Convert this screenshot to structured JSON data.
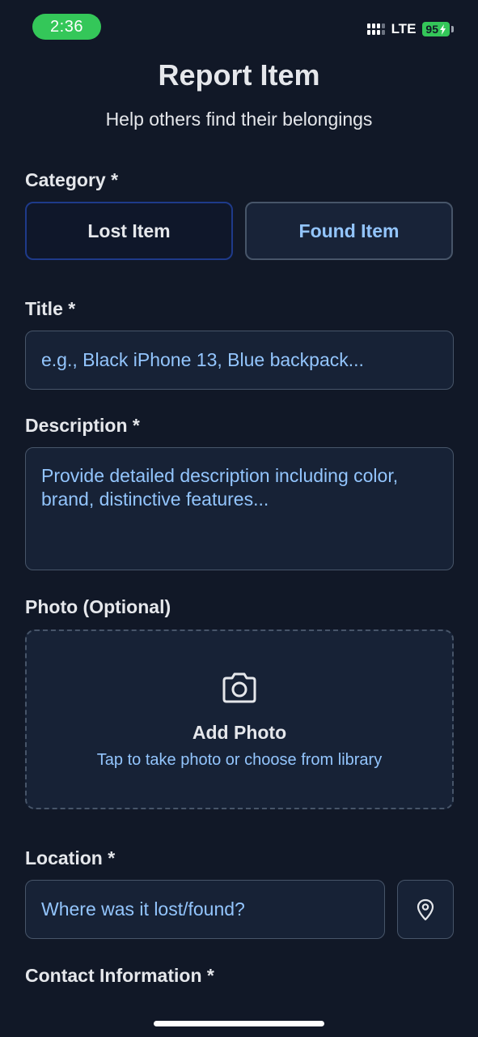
{
  "status_bar": {
    "time": "2:36",
    "network": "LTE",
    "battery": "95"
  },
  "header": {
    "title": "Report Item",
    "subtitle": "Help others find their belongings"
  },
  "form": {
    "category": {
      "label": "Category *",
      "options": [
        {
          "label": "Lost Item"
        },
        {
          "label": "Found Item"
        }
      ]
    },
    "title": {
      "label": "Title *",
      "placeholder": "e.g., Black iPhone 13, Blue backpack..."
    },
    "description": {
      "label": "Description *",
      "placeholder": "Provide detailed description including color, brand, distinctive features..."
    },
    "photo": {
      "label": "Photo (Optional)",
      "button_title": "Add Photo",
      "hint": "Tap to take photo or choose from library",
      "icon": "camera-icon"
    },
    "location": {
      "label": "Location *",
      "placeholder": "Where was it lost/found?",
      "icon": "map-pin-icon"
    },
    "contact": {
      "label": "Contact Information *"
    }
  },
  "colors": {
    "background": "#111827",
    "accent": "#93c5fd",
    "status_green": "#34c759"
  }
}
